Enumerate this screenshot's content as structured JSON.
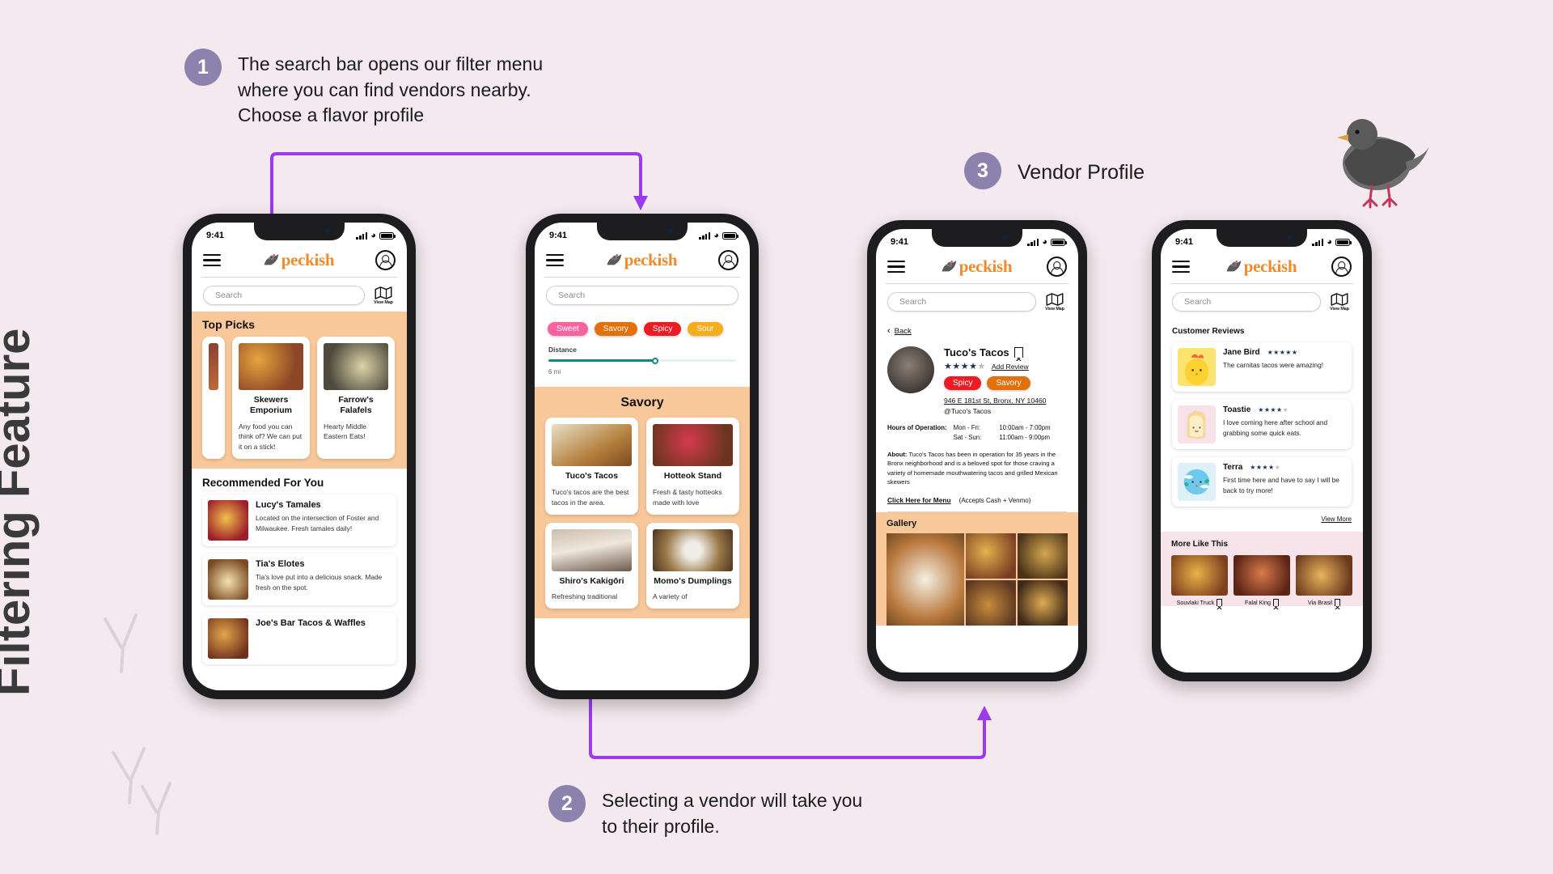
{
  "page": {
    "vertical_title": "Filtering Feature",
    "background_color": "#f4e9ee",
    "accent_purple": "#9b3bf0",
    "step_badge_color": "#8b83ae"
  },
  "annotations": [
    {
      "number": "1",
      "text": "The search bar opens our filter menu\nwhere you can find vendors nearby.\nChoose a flavor profile"
    },
    {
      "number": "2",
      "text": "Selecting a vendor will take you\nto their profile."
    },
    {
      "number": "3",
      "text": "Vendor Profile"
    }
  ],
  "app": {
    "name": "peckish",
    "status_time": "9:41",
    "search_placeholder": "Search",
    "view_map_label": "View Map",
    "menu_icon": "hamburger-menu-icon",
    "logo_icon": "bird-logo-icon",
    "account_icon": "account-avatar-icon",
    "map_icon": "map-icon"
  },
  "screen1": {
    "top_picks_title": "Top Picks",
    "top_picks": [
      {
        "name": "Skewers Emporium",
        "desc": "Any food you can think of? We can put it on a stick!"
      },
      {
        "name": "Farrow's Falafels",
        "desc": "Hearty Middle Eastern Eats!"
      }
    ],
    "recommended_title": "Recommended For You",
    "recommended": [
      {
        "name": "Lucy's Tamales",
        "desc": "Located on the intersection of Foster and Milwaukee. Fresh tamales daily!"
      },
      {
        "name": "Tia's Elotes",
        "desc": "Tia's love put into a delicious snack. Made fresh on the spot."
      },
      {
        "name": "Joe's Bar Tacos & Waffles",
        "desc": ""
      }
    ]
  },
  "screen2": {
    "filters": [
      {
        "label": "Sweet",
        "color": "#f9629f"
      },
      {
        "label": "Savory",
        "color": "#e2710c"
      },
      {
        "label": "Spicy",
        "color": "#ed1c24"
      },
      {
        "label": "Sour",
        "color": "#f7ad1a"
      }
    ],
    "distance_label": "Distance",
    "distance_value": "6 mi",
    "distance_percent": 57,
    "section_title": "Savory",
    "vendors": [
      {
        "name": "Tuco's Tacos",
        "desc": "Tuco's tacos are the best tacos in the area."
      },
      {
        "name": "Hotteok Stand",
        "desc": "Fresh & tasty hotteoks made with love"
      },
      {
        "name": "Shiro's Kakigōri",
        "desc": "Refreshing traditional"
      },
      {
        "name": "Momo's Dumplings",
        "desc": "A variety of"
      }
    ]
  },
  "screen3": {
    "back_label": "Back",
    "vendor_name": "Tuco's Tacos",
    "rating_filled": 4,
    "rating_total": 5,
    "add_review_label": "Add Review",
    "tags": [
      {
        "label": "Spicy",
        "color": "#ed1c24"
      },
      {
        "label": "Savory",
        "color": "#e2710c"
      }
    ],
    "address": "946 E 181st St, Bronx, NY 10460",
    "handle": "@Tuco's Tacos",
    "hours_label": "Hours of Operation:",
    "hours": [
      {
        "days": "Mon - Fri:",
        "time": "10:00am - 7:00pm"
      },
      {
        "days": "Sat - Sun:",
        "time": "11:00am - 9:00pm"
      }
    ],
    "about_label": "About:",
    "about_text": " Tuco's Tacos has been in operation for 35 years in the Bronx neighborhood and is a beloved spot for those craving a variety of homemade mouthwatering tacos and grilled Mexican skewers",
    "menu_link": "Click Here for Menu",
    "payment_note": "(Accepts Cash + Venmo)",
    "gallery_title": "Gallery",
    "bookmark_icon": "bookmark-icon"
  },
  "screen4": {
    "reviews_title": "Customer Reviews",
    "reviews": [
      {
        "name": "Jane Bird",
        "filled": 5,
        "text": "The carnitas tacos were amazing!"
      },
      {
        "name": "Toastie",
        "filled": 4,
        "text": "I love coming here after school and grabbing some quick eats."
      },
      {
        "name": "Terra",
        "filled": 4,
        "text": "First time here and have to say I will be back to try more!"
      }
    ],
    "view_more_label": "View More",
    "more_like_this_title": "More Like This",
    "more_like_this": [
      {
        "name": "Souvlaki Truck"
      },
      {
        "name": "Falal King"
      },
      {
        "name": "Via Brasil"
      }
    ]
  }
}
